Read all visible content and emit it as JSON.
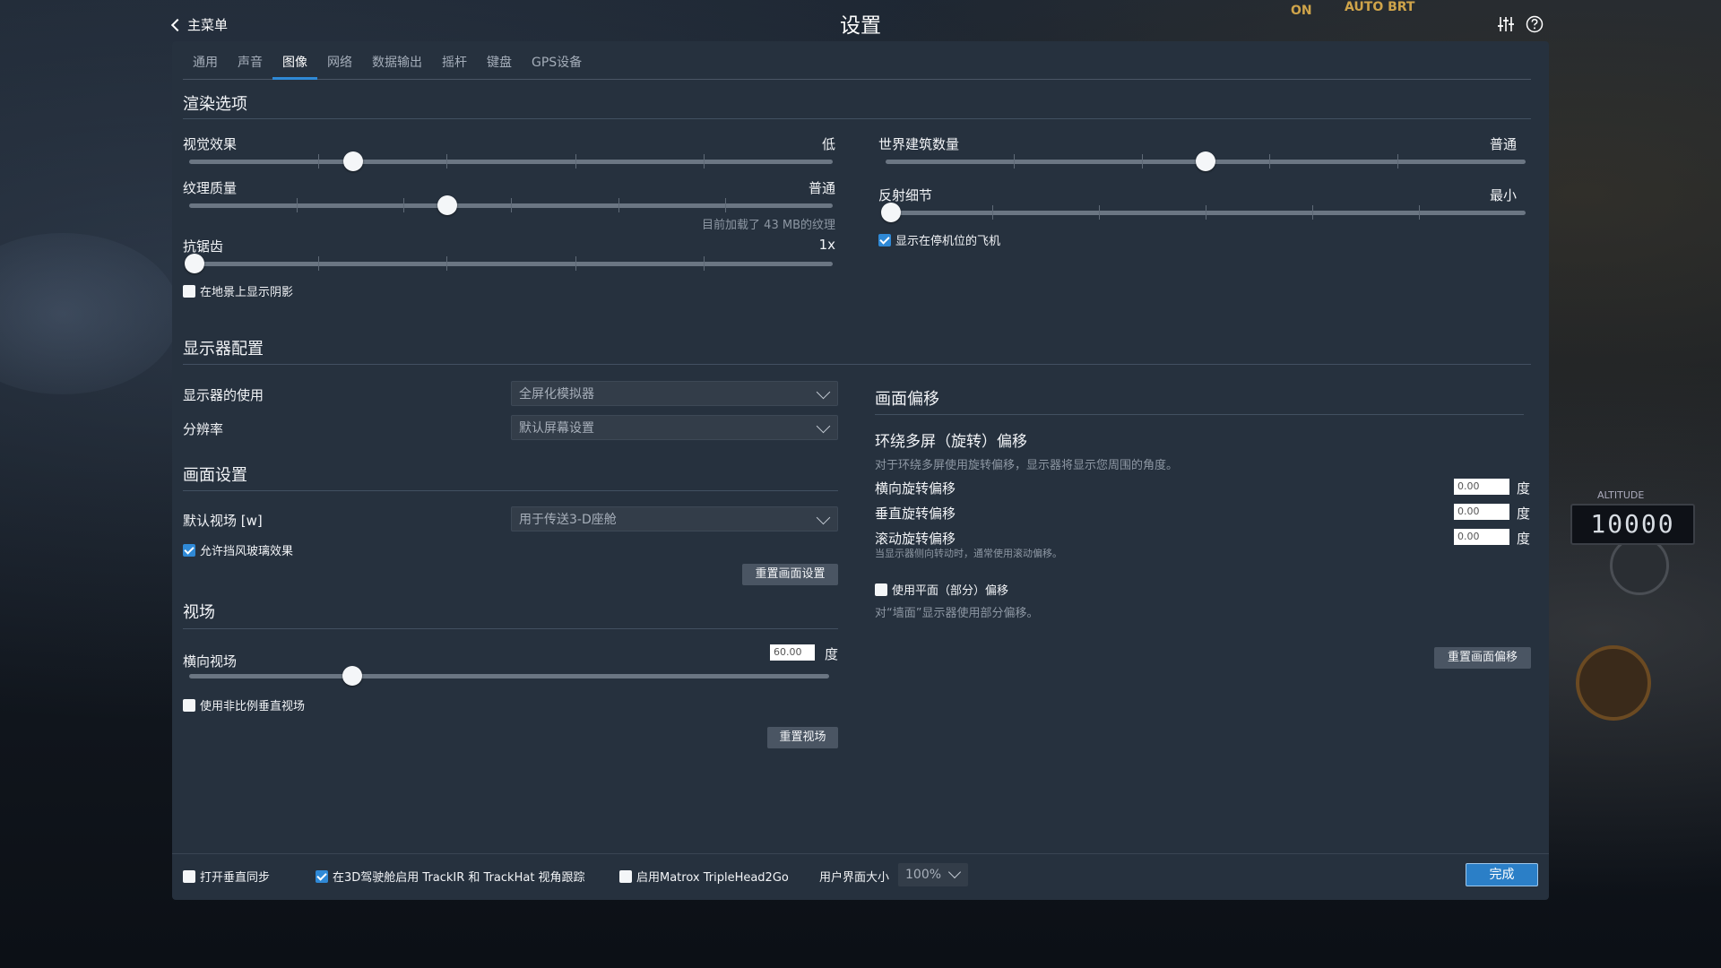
{
  "header": {
    "back_label": "主菜单",
    "title": "设置"
  },
  "tabs": [
    {
      "label": "通用",
      "active": false
    },
    {
      "label": "声音",
      "active": false
    },
    {
      "label": "图像",
      "active": true
    },
    {
      "label": "网络",
      "active": false
    },
    {
      "label": "数据输出",
      "active": false
    },
    {
      "label": "摇杆",
      "active": false
    },
    {
      "label": "键盘",
      "active": false
    },
    {
      "label": "GPS设备",
      "active": false
    }
  ],
  "rendering": {
    "title": "渲染选项",
    "visual_effects": {
      "label": "视觉效果",
      "value": "低",
      "level": 0.25
    },
    "texture_quality": {
      "label": "纹理质量",
      "value": "普通",
      "level": 0.4,
      "note": "目前加载了 43 MB的纹理"
    },
    "antialiasing": {
      "label": "抗锯齿",
      "value": "1x",
      "level": 0.0
    },
    "shadows_checkbox": {
      "label": "在地景上显示阴影",
      "checked": false
    },
    "world_objects": {
      "label": "世界建筑数量",
      "value": "普通",
      "level": 0.5
    },
    "reflection_detail": {
      "label": "反射细节",
      "value": "最小",
      "level": 0.0
    },
    "parked_aircraft_checkbox": {
      "label": "显示在停机位的飞机",
      "checked": true
    }
  },
  "monitor": {
    "title": "显示器配置",
    "monitor_usage": {
      "label": "显示器的使用",
      "value": "全屏化模拟器"
    },
    "resolution": {
      "label": "分辨率",
      "value": "默认屏幕设置"
    }
  },
  "view_settings": {
    "title": "画面设置",
    "default_fov": {
      "label": "默认视场 [w]",
      "value": "用于传送3-D座舱"
    },
    "windshield_checkbox": {
      "label": "允许挡风玻璃效果",
      "checked": true
    },
    "reset_button": "重置画面设置"
  },
  "fov": {
    "title": "视场",
    "horizontal": {
      "label": "横向视场",
      "value": "60.00",
      "unit": "度",
      "level": 0.25
    },
    "non_proportional_checkbox": {
      "label": "使用非比例垂直视场",
      "checked": false
    },
    "reset_button": "重置视场"
  },
  "offset": {
    "title": "画面偏移",
    "subtitle": "环绕多屏（旋转）偏移",
    "description": "对于环绕多屏使用旋转偏移，显示器将显示您周围的角度。",
    "lateral": {
      "label": "横向旋转偏移",
      "value": "0.00",
      "unit": "度"
    },
    "vertical": {
      "label": "垂直旋转偏移",
      "value": "0.00",
      "unit": "度"
    },
    "roll": {
      "label": "滚动旋转偏移",
      "value": "0.00",
      "unit": "度",
      "note": "当显示器侧向转动时，通常使用滚动偏移。"
    },
    "flat_checkbox": {
      "label": "使用平面（部分）偏移",
      "checked": false
    },
    "flat_note": "对“墙面”显示器使用部分偏移。",
    "reset_button": "重置画面偏移"
  },
  "footer": {
    "vsync": {
      "label": "打开垂直同步",
      "checked": false
    },
    "trackir": {
      "label": "在3D驾驶舱启用 TrackIR 和 TrackHat 视角跟踪",
      "checked": true
    },
    "matrox": {
      "label": "启用Matrox TripleHead2Go",
      "checked": false
    },
    "ui_size_label": "用户界面大小",
    "ui_size_value": "100%",
    "done_button": "完成"
  },
  "background": {
    "altitude_label": "ALTITUDE",
    "altitude_value": "10000",
    "panel_text_1": "ON",
    "panel_text_2": "AUTO BRT"
  },
  "colors": {
    "panel": "#26313e",
    "accent": "#2f89d6",
    "button": "#4a5563"
  },
  "icons": {
    "back": "chevron-left-icon",
    "adjust": "sliders-icon",
    "help": "help-circle-icon"
  }
}
